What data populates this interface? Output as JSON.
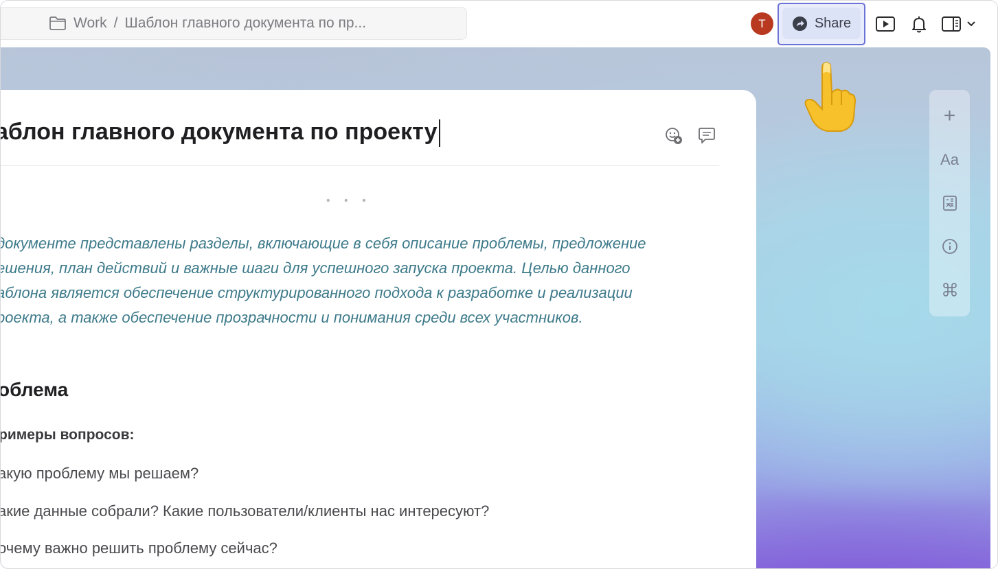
{
  "breadcrumb": {
    "workspace": "Work",
    "separator": "/",
    "doc": "Шаблон главного документа по пр..."
  },
  "header": {
    "avatar_letter": "T",
    "share_label": "Share",
    "icons": [
      "folder-icon",
      "share-arrow-icon",
      "present-icon",
      "bell-icon",
      "panel-toggle-icon",
      "chevron-down-icon"
    ]
  },
  "document": {
    "title": "аблон главного документа по проекту",
    "intro_lines": [
      "документе представлены разделы, включающие в себя описание проблемы, предложение",
      "ешения, план действий и важные шаги для успешного запуска проекта. Целью данного",
      "аблона является обеспечение структурированного подхода к разработке и реализации",
      "роекта, а также обеспечение прозрачности и понимания среди всех участников."
    ],
    "section_heading": "облема",
    "subheading": "римеры вопросов:",
    "questions": [
      "акую проблему мы решаем?",
      "акие данные собрали? Какие пользователи/клиенты нас интересуют?",
      "очему важно решить проблему сейчас?"
    ],
    "dots": "• • •"
  },
  "right_toolbar": {
    "plus": "+",
    "text_style": "Aa",
    "items": [
      "plus-icon",
      "text-style-icon",
      "template-icon",
      "info-icon",
      "command-icon"
    ]
  },
  "colors": {
    "accent": "#6c73d6",
    "avatar": "#b8391f",
    "intro_text": "#3d7a8a"
  }
}
